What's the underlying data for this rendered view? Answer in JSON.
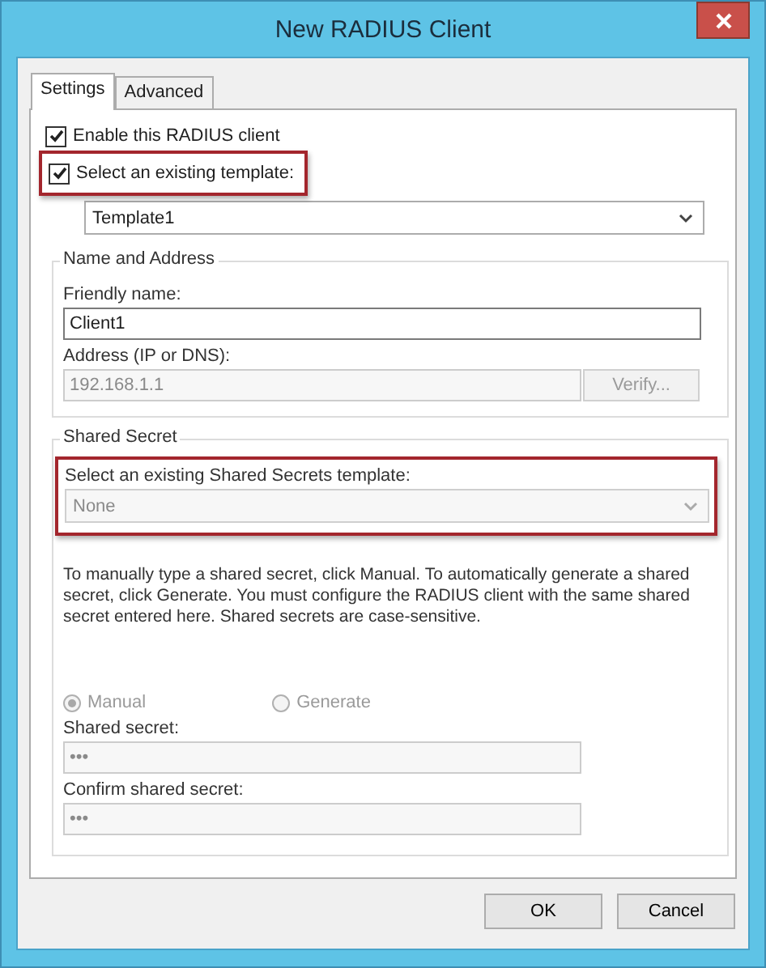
{
  "window": {
    "title": "New RADIUS Client"
  },
  "tabs": [
    {
      "label": "Settings",
      "selected": true
    },
    {
      "label": "Advanced",
      "selected": false
    }
  ],
  "enable_client": {
    "label": "Enable this RADIUS client",
    "checked": true
  },
  "use_template": {
    "label": "Select an existing template:",
    "checked": true,
    "highlighted": true
  },
  "template_dropdown": {
    "value": "Template1",
    "disabled": false
  },
  "name_and_address": {
    "title": "Name and Address",
    "friendly_name": {
      "label": "Friendly name:",
      "value": "Client1",
      "disabled": false
    },
    "address": {
      "label": "Address (IP or DNS):",
      "value": "192.168.1.1",
      "disabled": true
    },
    "verify_button": {
      "label": "Verify...",
      "disabled": true
    }
  },
  "shared_secret": {
    "title": "Shared Secret",
    "template_label": "Select an existing Shared Secrets template:",
    "template_dropdown": {
      "value": "None",
      "disabled": true,
      "highlighted": true
    },
    "description": "To manually type a shared secret, click Manual. To automatically generate a shared secret, click Generate. You must configure the RADIUS client with the same shared secret entered here. Shared secrets are case-sensitive.",
    "modes": [
      {
        "label": "Manual",
        "selected": true,
        "disabled": true
      },
      {
        "label": "Generate",
        "selected": false,
        "disabled": true
      }
    ],
    "secret": {
      "label": "Shared secret:",
      "value": "•••",
      "disabled": true
    },
    "confirm": {
      "label": "Confirm shared secret:",
      "value": "•••",
      "disabled": true
    }
  },
  "buttons": [
    {
      "label": "OK"
    },
    {
      "label": "Cancel"
    }
  ]
}
